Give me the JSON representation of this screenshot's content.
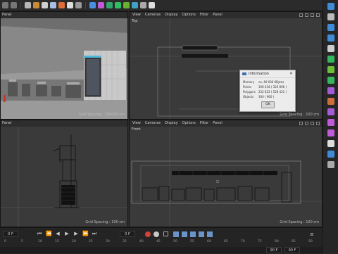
{
  "top_toolbar": {
    "icons": [
      "undo-icon",
      "redo-icon",
      "select-icon",
      "move-icon",
      "scale-icon",
      "rotate-icon",
      "coordinate-icon",
      "render-icon",
      "render-settings-icon",
      "cube-icon",
      "pen-icon",
      "subdivision-icon",
      "cloner-icon",
      "deformer-icon",
      "environment-icon",
      "camera-icon",
      "light-icon"
    ]
  },
  "right_toolbar": {
    "icons": [
      "cube-icon",
      "pen-icon",
      "nurbs-icon",
      "volume-icon",
      "text-icon",
      "mograph-icon",
      "deformer-icon",
      "field-icon",
      "tag-icon",
      "scene-icon",
      "camera-icon",
      "light-icon",
      "floor-icon",
      "sky-icon",
      "material-icon",
      "render-icon"
    ]
  },
  "viewports": {
    "perspective": {
      "menu_partial": "",
      "panel_label": "Panel",
      "grid_label": "Grid Spacing : 100000 cm"
    },
    "top": {
      "menu": [
        "View",
        "Cameras",
        "Display",
        "Options",
        "Filter",
        "Panel"
      ],
      "name": "Top",
      "grid_label": "Grid Spacing : 100 cm"
    },
    "right": {
      "menu_partial": "",
      "panel_label": "Panel",
      "grid_label": "Grid Spacing : 100 cm"
    },
    "front": {
      "menu": [
        "View",
        "Cameras",
        "Display",
        "Options",
        "Filter",
        "Panel"
      ],
      "name": "Front",
      "grid_label": "Grid Spacing : 100 cm"
    }
  },
  "dialog": {
    "title": "Information",
    "rows": [
      {
        "k": "Memory",
        "v": "ca. 40 600 KBytes"
      },
      {
        "k": "Points",
        "v": "196 034 ( 320 896 )"
      },
      {
        "k": "Polygons",
        "v": "232 823 ( 528 421 )"
      },
      {
        "k": "Objects",
        "v": "300 ( 960 )"
      }
    ],
    "ok_label": "OK"
  },
  "timeline": {
    "current_frame": "0 F",
    "start_field": "0 F",
    "end_field": "90 F",
    "end_field2": "90 F",
    "ruler": [
      "0",
      "5",
      "10",
      "15",
      "20",
      "25",
      "30",
      "35",
      "40",
      "45",
      "50",
      "55",
      "60",
      "65",
      "70",
      "75",
      "80",
      "85",
      "90"
    ]
  },
  "colors": {
    "accent_red": "#d0413a",
    "accent_blue": "#3f6fb0",
    "viewport_bg": "#3a3a3a"
  }
}
